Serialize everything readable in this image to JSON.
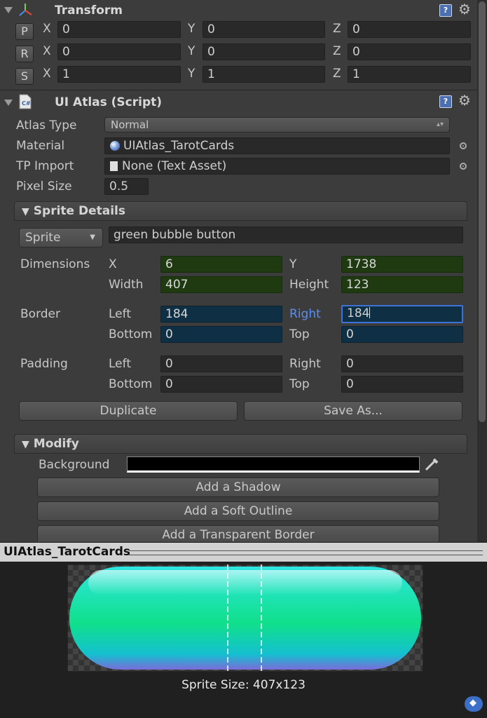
{
  "transform": {
    "title": "Transform",
    "rows": [
      {
        "button": "P",
        "x_label": "X",
        "x": "0",
        "y_label": "Y",
        "y": "0",
        "z_label": "Z",
        "z": "0"
      },
      {
        "button": "R",
        "x_label": "X",
        "x": "0",
        "y_label": "Y",
        "y": "0",
        "z_label": "Z",
        "z": "0"
      },
      {
        "button": "S",
        "x_label": "X",
        "x": "1",
        "y_label": "Y",
        "y": "1",
        "z_label": "Z",
        "z": "1"
      }
    ]
  },
  "ui_atlas": {
    "title": "UI Atlas (Script)",
    "atlas_type_label": "Atlas Type",
    "atlas_type_value": "Normal",
    "material_label": "Material",
    "material_value": "UIAtlas_TarotCards",
    "tp_import_label": "TP Import",
    "tp_import_value": "None (Text Asset)",
    "pixel_size_label": "Pixel Size",
    "pixel_size_value": "0.5"
  },
  "sprite_details": {
    "header": "Sprite Details",
    "sprite_dropdown": "Sprite",
    "sprite_name": "green bubble button",
    "dimensions_label": "Dimensions",
    "x_label": "X",
    "x": "6",
    "y_label": "Y",
    "y": "1738",
    "width_label": "Width",
    "width": "407",
    "height_label": "Height",
    "height": "123",
    "border_label": "Border",
    "border_left_label": "Left",
    "border_left": "184",
    "border_right_label": "Right",
    "border_right": "184",
    "border_bottom_label": "Bottom",
    "border_bottom": "0",
    "border_top_label": "Top",
    "border_top": "0",
    "padding_label": "Padding",
    "padding_left_label": "Left",
    "padding_left": "0",
    "padding_right_label": "Right",
    "padding_right": "0",
    "padding_bottom_label": "Bottom",
    "padding_bottom": "0",
    "padding_top_label": "Top",
    "padding_top": "0",
    "duplicate_button": "Duplicate",
    "save_as_button": "Save As..."
  },
  "modify": {
    "header": "Modify",
    "background_label": "Background",
    "background_color": "#000000",
    "add_shadow": "Add a Shadow",
    "add_soft_outline": "Add a Soft Outline",
    "add_transparent_border": "Add a Transparent Border"
  },
  "preview": {
    "title": "UIAtlas_TarotCards",
    "sprite_size": "Sprite Size: 407x123"
  },
  "colors": {
    "panel": "#3c3c3c",
    "green_field": "#1f3a11",
    "blue_field": "#0f2f45",
    "focus_border": "#3d73d8",
    "active_label": "#5a8ef0"
  },
  "icons": [
    "transform-axes-icon",
    "csharp-script-icon",
    "help-icon",
    "gear-icon",
    "material-sphere-icon",
    "text-asset-icon",
    "object-picker-icon",
    "eyedropper-icon",
    "asset-label-icon"
  ]
}
